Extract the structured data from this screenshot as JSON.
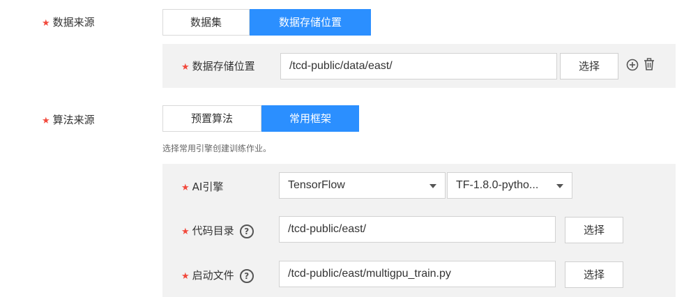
{
  "data_source": {
    "label": "数据来源",
    "options": [
      "数据集",
      "数据存储位置"
    ],
    "selected": "数据存储位置",
    "storage": {
      "label": "数据存储位置",
      "value": "/tcd-public/data/east/",
      "button": "选择"
    }
  },
  "algorithm_source": {
    "label": "算法来源",
    "options": [
      "预置算法",
      "常用框架"
    ],
    "selected": "常用框架",
    "hint": "选择常用引擎创建训练作业。",
    "ai_engine": {
      "label": "AI引擎",
      "engine": "TensorFlow",
      "version": "TF-1.8.0-pytho..."
    },
    "code_dir": {
      "label": "代码目录",
      "value": "/tcd-public/east/",
      "button": "选择"
    },
    "boot_file": {
      "label": "启动文件",
      "value": "/tcd-public/east/multigpu_train.py",
      "button": "选择"
    }
  },
  "colors": {
    "accent": "#2b8fff",
    "required": "#f2493c",
    "panel": "#f2f2f2"
  },
  "icons": [
    "add-circle-icon",
    "trash-icon",
    "help-icon",
    "chevron-down-icon"
  ]
}
